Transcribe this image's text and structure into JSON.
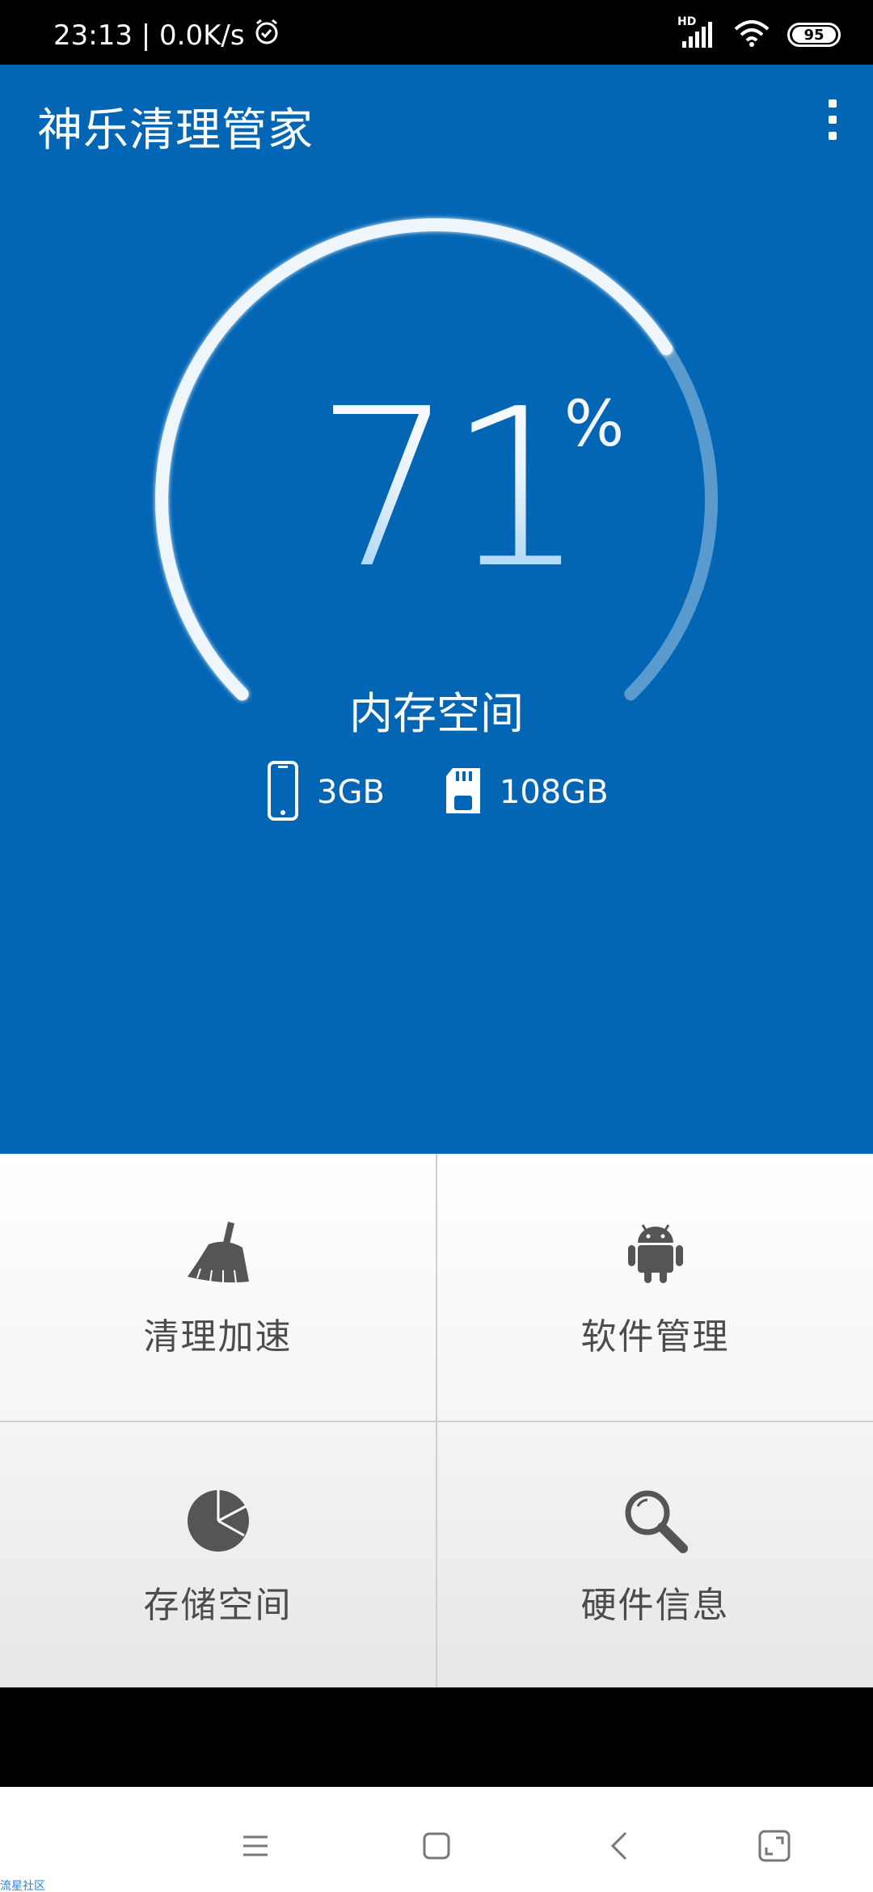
{
  "status_bar": {
    "time_speed": "23:13 | 0.0K/s",
    "network": "HD",
    "battery": "95"
  },
  "header": {
    "title": "神乐清理管家"
  },
  "gauge": {
    "percent_value": "71",
    "percent_sign": "%",
    "fill_fraction": 0.71,
    "label": "内存空间"
  },
  "storage": {
    "ram": "3GB",
    "disk": "108GB"
  },
  "menu": [
    {
      "label": "清理加速",
      "icon": "broom-icon"
    },
    {
      "label": "软件管理",
      "icon": "android-icon"
    },
    {
      "label": "存储空间",
      "icon": "pie-chart-icon"
    },
    {
      "label": "硬件信息",
      "icon": "magnifier-icon"
    }
  ],
  "watermark": "流星社区",
  "colors": {
    "primary_blue": "#0366B5",
    "icon_gray": "#555555"
  }
}
